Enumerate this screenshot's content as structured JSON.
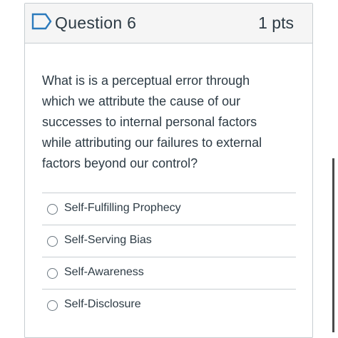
{
  "header": {
    "title": "Question 6",
    "points": "1 pts",
    "flag_icon": "flag-outline-icon"
  },
  "question": {
    "text": "What is is a perceptual error through which we attribute the cause of our successes to internal personal factors while attributing our failures to external factors beyond our control?"
  },
  "answers": [
    {
      "label": "Self-Fulfilling Prophecy",
      "selected": false
    },
    {
      "label": "Self-Serving Bias",
      "selected": false
    },
    {
      "label": "Self-Awareness",
      "selected": false
    },
    {
      "label": "Self-Disclosure",
      "selected": false
    }
  ],
  "colors": {
    "border": "#c7cdd1",
    "header_bg": "#f5f5f5",
    "text": "#2d3b45",
    "flag": "#2b7abc"
  }
}
